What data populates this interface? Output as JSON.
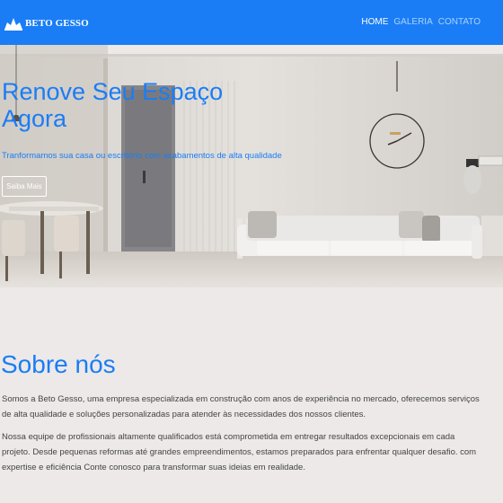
{
  "navbar": {
    "brand_name": "BETO GESSO",
    "brand_logo": "house-logo-icon",
    "links": [
      {
        "label": "HOME",
        "active": true
      },
      {
        "label": "GALERIA",
        "active": false
      },
      {
        "label": "CONTATO",
        "active": false
      }
    ]
  },
  "hero": {
    "title": "Renove Seu Espaço Agora",
    "subtitle": "Tranformamos sua casa ou escritório com acabamentos de alta qualidade",
    "button_label": "Saiba Mais",
    "image": "living-room-photo"
  },
  "about": {
    "title": "Sobre nós",
    "paragraphs": [
      "Somos a Beto Gesso, uma empresa especializada em construção com anos de experiência no mercado, oferecemos serviços de alta qualidade e soluções personalizadas para atender às necessidades dos nossos clientes.",
      "Nossa equipe de profissionais altamente qualificados está comprometida em entregar resultados excepcionais em cada projeto. Desde pequenas reformas até grandes empreendimentos, estamos preparados para enfrentar qualquer desafio. com expertise e eficiência Conte conosco para transformar suas ideias em realidade."
    ]
  },
  "colors": {
    "accent": "#1a7df5",
    "page_background": "#ece9e8",
    "body_text": "#444444"
  }
}
